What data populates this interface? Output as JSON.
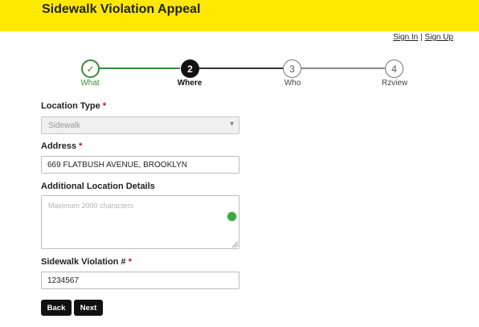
{
  "header": {
    "title": "Sidewalk Violation Appeal"
  },
  "auth": {
    "sign_in": "Sign In",
    "separator": "|",
    "sign_up": "Sign Up"
  },
  "steps": [
    {
      "number": "✓",
      "label": "What",
      "state": "done"
    },
    {
      "number": "2",
      "label": "Where",
      "state": "current"
    },
    {
      "number": "3",
      "label": "Who",
      "state": "todo"
    },
    {
      "number": "4",
      "label": "Rzview",
      "state": "todo"
    }
  ],
  "form": {
    "location_type": {
      "label": "Location Type",
      "required": "*",
      "value": "Sidewalk"
    },
    "address": {
      "label": "Address",
      "required": "*",
      "value": "669 FLATBUSH AVENUE, BROOKLYN"
    },
    "additional_details": {
      "label": "Additional Location Details",
      "placeholder": "Maximum 2000 characters"
    },
    "violation_number": {
      "label": "Sidewalk Violation #",
      "required": "*",
      "value": "1234567"
    }
  },
  "buttons": {
    "back": "Back",
    "next": "Next"
  },
  "colors": {
    "header_bg": "#ffe900",
    "step_done": "#3b8a3a",
    "required": "#d0021b",
    "button_bg": "#111111"
  }
}
